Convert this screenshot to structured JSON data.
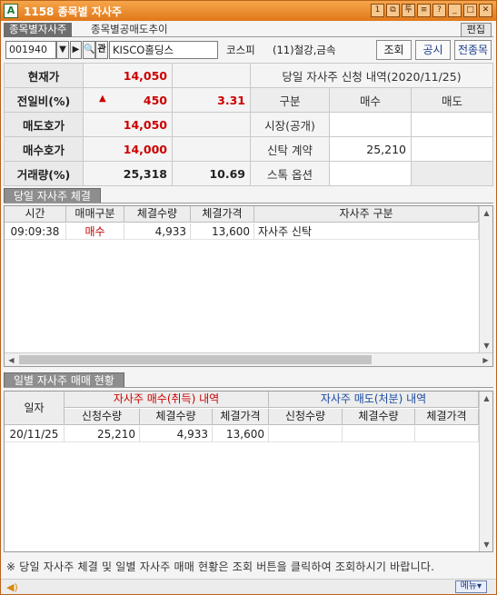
{
  "window": {
    "title": "1158 종목별 자사주",
    "icon": "A",
    "buttons": [
      "1",
      "⧉",
      "투",
      "≡",
      "?",
      "_",
      "□",
      "✕"
    ]
  },
  "tabs": [
    "종목별자사주",
    "종목별공매도추이"
  ],
  "edit_label": "편집",
  "search": {
    "code": "001940",
    "name": "KISCO홀딩스",
    "market": "코스피",
    "industry": "(11)철강,금속",
    "query_label": "조회",
    "notice_label": "공시",
    "all_label": "전종목"
  },
  "quote": {
    "rows": [
      {
        "label": "현재가",
        "value": "14,050",
        "extra": ""
      },
      {
        "label": "전일비(%)",
        "value": "450",
        "extra": "3.31",
        "arrow": "▲"
      },
      {
        "label": "매도호가",
        "value": "14,050",
        "extra": ""
      },
      {
        "label": "매수호가",
        "value": "14,000",
        "extra": ""
      },
      {
        "label": "거래량(%)",
        "value": "25,318",
        "extra": "10.69"
      }
    ],
    "application": {
      "title": "당일 자사주 신청 내역(2020/11/25)",
      "headers": [
        "구분",
        "매수",
        "매도"
      ],
      "rows": [
        {
          "label": "시장(공개)",
          "buy": "",
          "sell": ""
        },
        {
          "label": "신탁 계약",
          "buy": "25,210",
          "sell": ""
        },
        {
          "label": "스톡 옵션",
          "buy": "",
          "sell": ""
        }
      ]
    }
  },
  "today_section": {
    "title": "당일 자사주 체결",
    "headers": [
      "시간",
      "매매구분",
      "체결수량",
      "체결가격",
      "자사주 구분"
    ],
    "rows": [
      {
        "time": "09:09:38",
        "type": "매수",
        "qty": "4,933",
        "price": "13,600",
        "category": "자사주 신탁"
      }
    ]
  },
  "daily_section": {
    "title": "일별 자사주 매매 현황",
    "date_header": "일자",
    "buy_group": "자사주 매수(취득) 내역",
    "sell_group": "자사주 매도(처분) 내역",
    "sub_headers": [
      "신청수량",
      "체결수량",
      "체결가격",
      "신청수량",
      "체결수량",
      "체결가격"
    ],
    "rows": [
      {
        "date": "20/11/25",
        "b_req": "25,210",
        "b_qty": "4,933",
        "b_price": "13,600",
        "s_req": "",
        "s_qty": "",
        "s_price": ""
      }
    ]
  },
  "notice": "※ 당일 자사주 체결 및 일별 자사주 매매 현황은 조회 버튼을 클릭하여 조회하시기 바랍니다.",
  "status": {
    "menu_label": "메뉴▾"
  },
  "colors": {
    "title_bar": "#e8862a",
    "buy_red": "#cc0000",
    "sell_blue": "#1a4aa0"
  }
}
